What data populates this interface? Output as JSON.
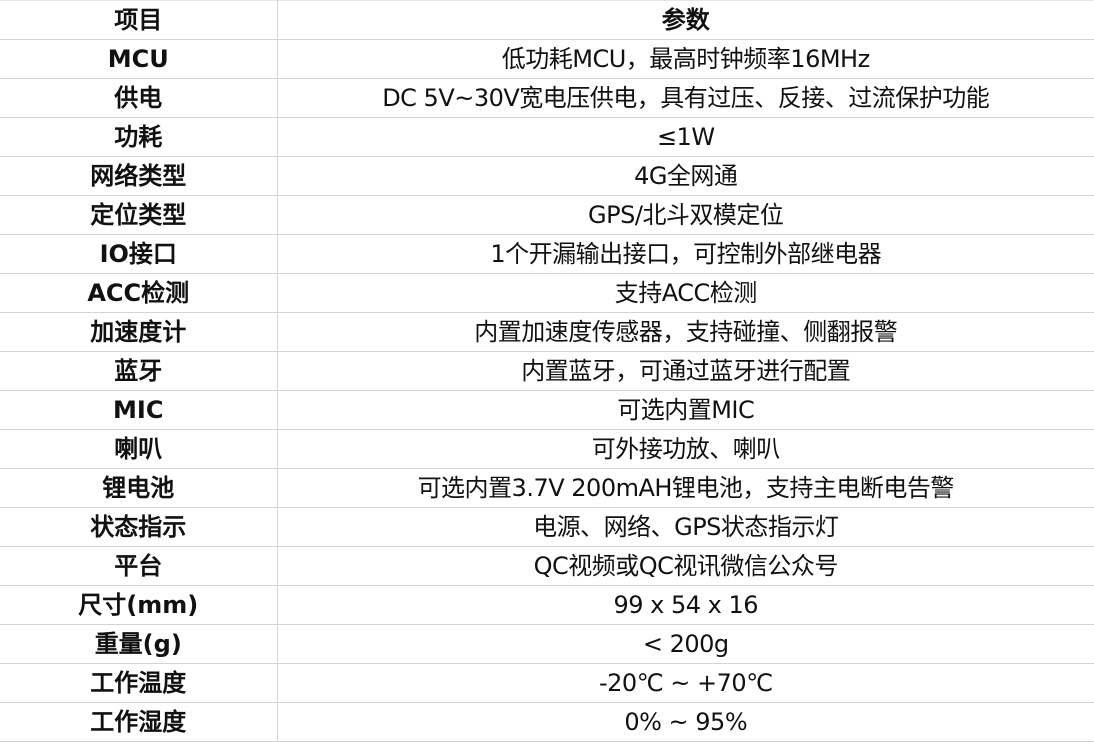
{
  "table": {
    "headers": [
      "项目",
      "参数"
    ],
    "rows": [
      {
        "item": "MCU",
        "value": "低功耗MCU，最高时钟频率16MHz"
      },
      {
        "item": "供电",
        "value": "DC 5V~30V宽电压供电，具有过压、反接、过流保护功能"
      },
      {
        "item": "功耗",
        "value": "≤1W"
      },
      {
        "item": "网络类型",
        "value": "4G全网通"
      },
      {
        "item": "定位类型",
        "value": "GPS/北斗双模定位"
      },
      {
        "item": "IO接口",
        "value": "1个开漏输出接口，可控制外部继电器"
      },
      {
        "item": "ACC检测",
        "value": "支持ACC检测"
      },
      {
        "item": "加速度计",
        "value": "内置加速度传感器，支持碰撞、侧翻报警"
      },
      {
        "item": "蓝牙",
        "value": "内置蓝牙，可通过蓝牙进行配置"
      },
      {
        "item": "MIC",
        "value": "可选内置MIC"
      },
      {
        "item": "喇叭",
        "value": "可外接功放、喇叭"
      },
      {
        "item": "锂电池",
        "value": "可选内置3.7V 200mAH锂电池，支持主电断电告警"
      },
      {
        "item": "状态指示",
        "value": "电源、网络、GPS状态指示灯"
      },
      {
        "item": "平台",
        "value": "QC视频或QC视讯微信公众号"
      },
      {
        "item": "尺寸(mm)",
        "value": "99 x 54 x 16"
      },
      {
        "item": "重量(g)",
        "value": "< 200g"
      },
      {
        "item": "工作温度",
        "value": "-20℃ ~ +70℃"
      },
      {
        "item": "工作湿度",
        "value": "0% ~ 95%"
      }
    ]
  }
}
